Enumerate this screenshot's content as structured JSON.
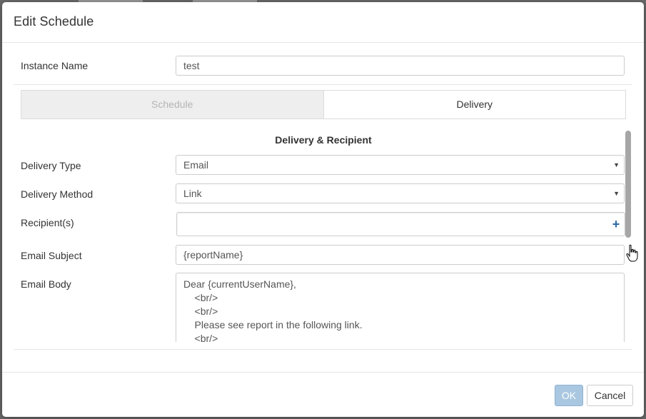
{
  "dialog": {
    "title": "Edit Schedule"
  },
  "instance": {
    "label": "Instance Name",
    "value": "test"
  },
  "tabs": [
    {
      "label": "Schedule",
      "active": false
    },
    {
      "label": "Delivery",
      "active": true
    }
  ],
  "delivery": {
    "heading": "Delivery & Recipient",
    "type_label": "Delivery Type",
    "type_value": "Email",
    "method_label": "Delivery Method",
    "method_value": "Link",
    "recipients_label": "Recipient(s)",
    "recipients_value": "",
    "subject_label": "Email Subject",
    "subject_value": "{reportName}",
    "body_label": "Email Body",
    "body_value": "Dear {currentUserName},\n    <br/>\n    <br/>\n    Please see report in the following link.\n    <br/>"
  },
  "footer": {
    "ok_label": "OK",
    "cancel_label": "Cancel"
  },
  "colors": {
    "ok_button": "#a9c7e0",
    "plus_icon": "#2a6aa8",
    "inactive_tab": "#eeeeee"
  }
}
